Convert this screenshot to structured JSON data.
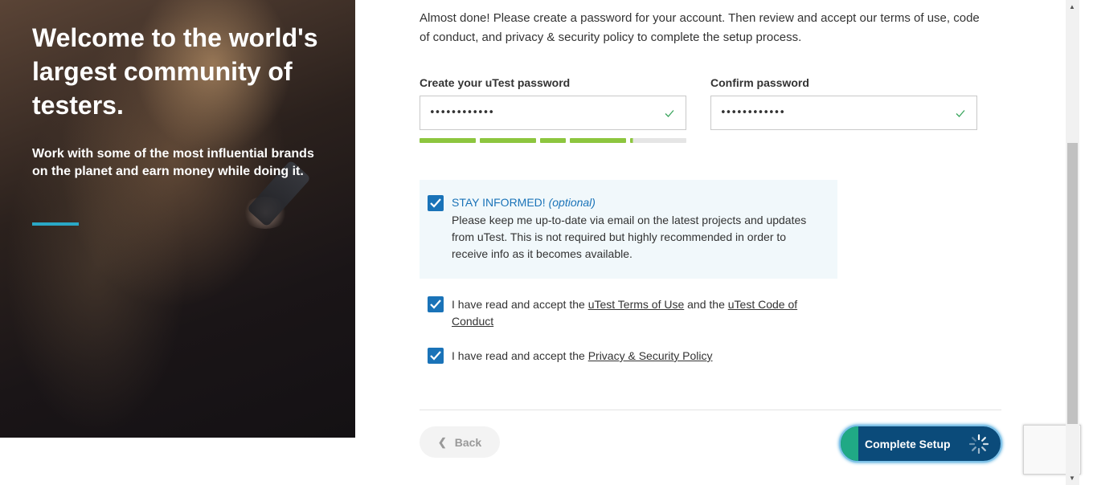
{
  "hero": {
    "title": "Welcome to the world's largest community of testers.",
    "subtitle": "Work with some of the most influential brands on the planet and earn money while doing it.",
    "accent_color": "#2aa8c6"
  },
  "intro": "Almost done! Please create a password for your account. Then review and accept our terms of use, code of conduct, and privacy & security policy to complete the setup process.",
  "password": {
    "label": "Create your uTest password",
    "value": "••••••••••••",
    "valid_icon": "check-icon"
  },
  "confirm_password": {
    "label": "Confirm password",
    "value": "••••••••••••",
    "valid_icon": "check-icon"
  },
  "strength_meter": {
    "level": 0.8,
    "filled_color": "#8dc63f",
    "empty_color": "#e5e5e5"
  },
  "stay_informed": {
    "checked": true,
    "title": "STAY INFORMED!",
    "optional": "(optional)",
    "body": "Please keep me up-to-date via email on the latest projects and updates from uTest. This is not required but highly recommended in order to receive info as it becomes available."
  },
  "terms": {
    "checked": true,
    "prefix": "I have read and accept the ",
    "terms_link": "uTest Terms of Use",
    "middle": " and the ",
    "conduct_link": "uTest Code of Conduct"
  },
  "privacy": {
    "checked": true,
    "prefix": "I have read and accept the ",
    "privacy_link": "Privacy & Security Policy"
  },
  "buttons": {
    "back": "Back",
    "complete": "Complete Setup"
  },
  "colors": {
    "checkbox": "#1a73b8",
    "complete_button": "#0b4b7a",
    "complete_progress": "#20a985"
  }
}
